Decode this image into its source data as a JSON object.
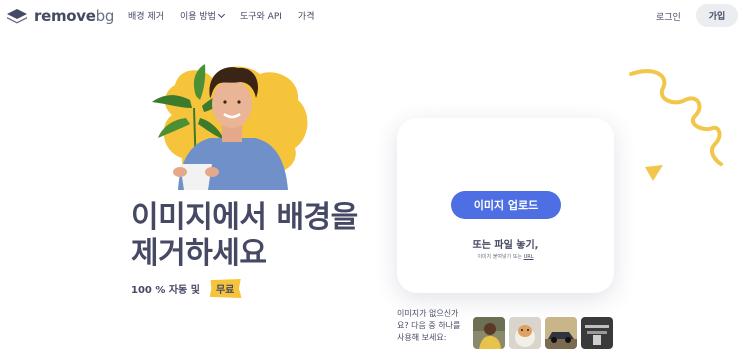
{
  "header": {
    "logo_main": "remove",
    "logo_bg": "bg",
    "nav": [
      {
        "label": "배경 제거"
      },
      {
        "label": "이용 방법"
      },
      {
        "label": "도구와 API"
      },
      {
        "label": "가격"
      }
    ],
    "login_label": "로그인",
    "signup_label": "가입"
  },
  "hero": {
    "headline_line1": "이미지에서 배경을",
    "headline_line2": "제거하세요",
    "subline": "100 % 자동 및",
    "free_badge": "무료"
  },
  "upload": {
    "button_label": "이미지 업로드",
    "or_drop": "또는 파일 놓기,",
    "paste_hint": "이미지 붙여넣기 또는",
    "url_label": "URL"
  },
  "samples": {
    "no_image_text": "이미지가 없으신가요? 다음 중 하나를 사용해 보세요:"
  },
  "colors": {
    "primary": "#4e6ee3",
    "text": "#454964",
    "accent_yellow": "#f6c43a"
  }
}
